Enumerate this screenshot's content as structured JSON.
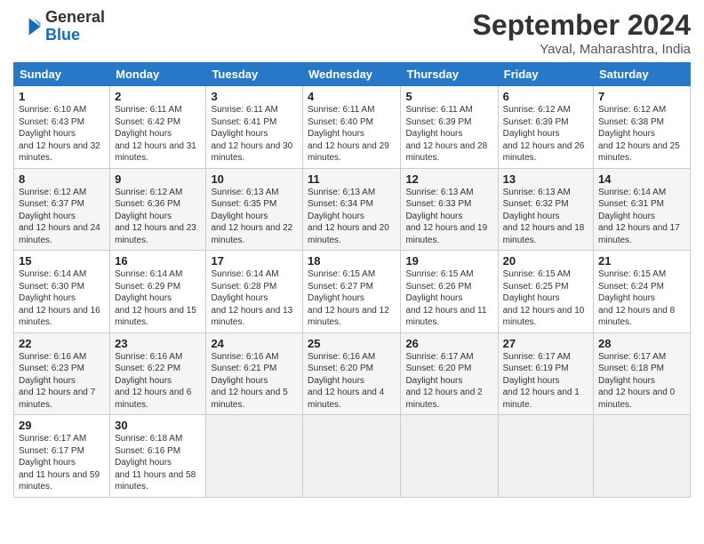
{
  "header": {
    "logo_line1": "General",
    "logo_line2": "Blue",
    "month": "September 2024",
    "location": "Yaval, Maharashtra, India"
  },
  "weekdays": [
    "Sunday",
    "Monday",
    "Tuesday",
    "Wednesday",
    "Thursday",
    "Friday",
    "Saturday"
  ],
  "weeks": [
    [
      {
        "day": "1",
        "sunrise": "6:10 AM",
        "sunset": "6:43 PM",
        "daylight": "12 hours and 32 minutes."
      },
      {
        "day": "2",
        "sunrise": "6:11 AM",
        "sunset": "6:42 PM",
        "daylight": "12 hours and 31 minutes."
      },
      {
        "day": "3",
        "sunrise": "6:11 AM",
        "sunset": "6:41 PM",
        "daylight": "12 hours and 30 minutes."
      },
      {
        "day": "4",
        "sunrise": "6:11 AM",
        "sunset": "6:40 PM",
        "daylight": "12 hours and 29 minutes."
      },
      {
        "day": "5",
        "sunrise": "6:11 AM",
        "sunset": "6:39 PM",
        "daylight": "12 hours and 28 minutes."
      },
      {
        "day": "6",
        "sunrise": "6:12 AM",
        "sunset": "6:39 PM",
        "daylight": "12 hours and 26 minutes."
      },
      {
        "day": "7",
        "sunrise": "6:12 AM",
        "sunset": "6:38 PM",
        "daylight": "12 hours and 25 minutes."
      }
    ],
    [
      {
        "day": "8",
        "sunrise": "6:12 AM",
        "sunset": "6:37 PM",
        "daylight": "12 hours and 24 minutes."
      },
      {
        "day": "9",
        "sunrise": "6:12 AM",
        "sunset": "6:36 PM",
        "daylight": "12 hours and 23 minutes."
      },
      {
        "day": "10",
        "sunrise": "6:13 AM",
        "sunset": "6:35 PM",
        "daylight": "12 hours and 22 minutes."
      },
      {
        "day": "11",
        "sunrise": "6:13 AM",
        "sunset": "6:34 PM",
        "daylight": "12 hours and 20 minutes."
      },
      {
        "day": "12",
        "sunrise": "6:13 AM",
        "sunset": "6:33 PM",
        "daylight": "12 hours and 19 minutes."
      },
      {
        "day": "13",
        "sunrise": "6:13 AM",
        "sunset": "6:32 PM",
        "daylight": "12 hours and 18 minutes."
      },
      {
        "day": "14",
        "sunrise": "6:14 AM",
        "sunset": "6:31 PM",
        "daylight": "12 hours and 17 minutes."
      }
    ],
    [
      {
        "day": "15",
        "sunrise": "6:14 AM",
        "sunset": "6:30 PM",
        "daylight": "12 hours and 16 minutes."
      },
      {
        "day": "16",
        "sunrise": "6:14 AM",
        "sunset": "6:29 PM",
        "daylight": "12 hours and 15 minutes."
      },
      {
        "day": "17",
        "sunrise": "6:14 AM",
        "sunset": "6:28 PM",
        "daylight": "12 hours and 13 minutes."
      },
      {
        "day": "18",
        "sunrise": "6:15 AM",
        "sunset": "6:27 PM",
        "daylight": "12 hours and 12 minutes."
      },
      {
        "day": "19",
        "sunrise": "6:15 AM",
        "sunset": "6:26 PM",
        "daylight": "12 hours and 11 minutes."
      },
      {
        "day": "20",
        "sunrise": "6:15 AM",
        "sunset": "6:25 PM",
        "daylight": "12 hours and 10 minutes."
      },
      {
        "day": "21",
        "sunrise": "6:15 AM",
        "sunset": "6:24 PM",
        "daylight": "12 hours and 8 minutes."
      }
    ],
    [
      {
        "day": "22",
        "sunrise": "6:16 AM",
        "sunset": "6:23 PM",
        "daylight": "12 hours and 7 minutes."
      },
      {
        "day": "23",
        "sunrise": "6:16 AM",
        "sunset": "6:22 PM",
        "daylight": "12 hours and 6 minutes."
      },
      {
        "day": "24",
        "sunrise": "6:16 AM",
        "sunset": "6:21 PM",
        "daylight": "12 hours and 5 minutes."
      },
      {
        "day": "25",
        "sunrise": "6:16 AM",
        "sunset": "6:20 PM",
        "daylight": "12 hours and 4 minutes."
      },
      {
        "day": "26",
        "sunrise": "6:17 AM",
        "sunset": "6:20 PM",
        "daylight": "12 hours and 2 minutes."
      },
      {
        "day": "27",
        "sunrise": "6:17 AM",
        "sunset": "6:19 PM",
        "daylight": "12 hours and 1 minute."
      },
      {
        "day": "28",
        "sunrise": "6:17 AM",
        "sunset": "6:18 PM",
        "daylight": "12 hours and 0 minutes."
      }
    ],
    [
      {
        "day": "29",
        "sunrise": "6:17 AM",
        "sunset": "6:17 PM",
        "daylight": "11 hours and 59 minutes."
      },
      {
        "day": "30",
        "sunrise": "6:18 AM",
        "sunset": "6:16 PM",
        "daylight": "11 hours and 58 minutes."
      },
      null,
      null,
      null,
      null,
      null
    ]
  ]
}
